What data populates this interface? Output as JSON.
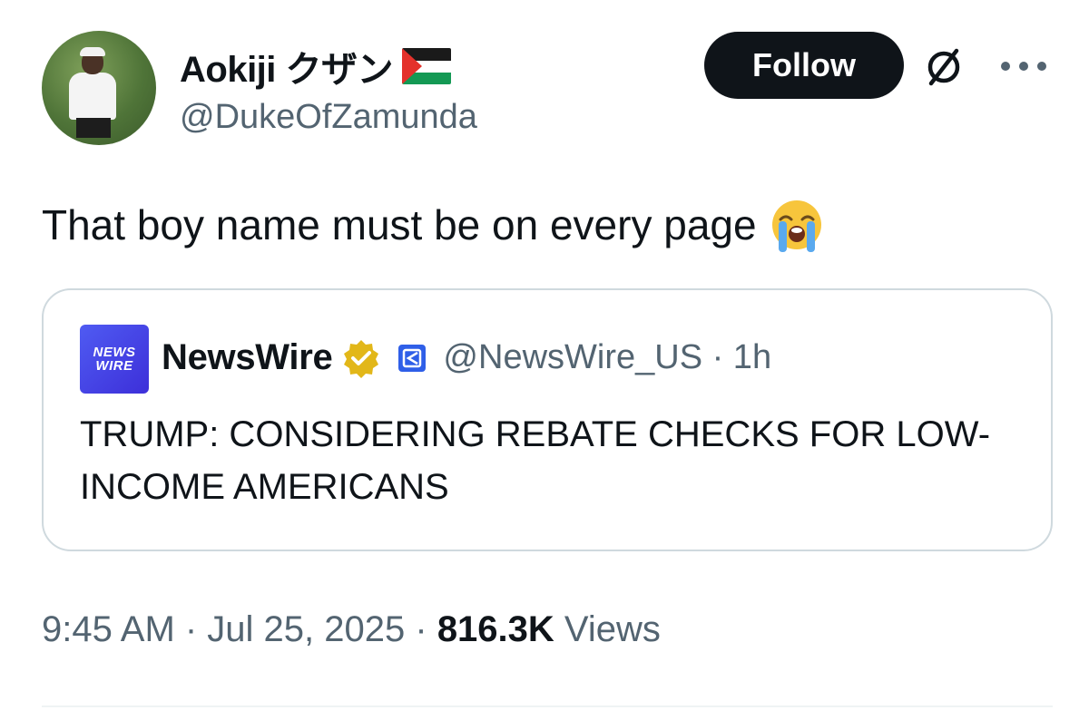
{
  "author": {
    "display_name": "Aokiji クザン",
    "handle": "@DukeOfZamunda",
    "flag_icon": "palestine-flag-icon"
  },
  "header": {
    "follow_label": "Follow",
    "grok_icon": "grok-icon",
    "more_icon": "more-options-icon"
  },
  "tweet": {
    "text": "That boy name must be on every page",
    "emoji_icon": "loudly-crying-face-emoji"
  },
  "quoted_tweet": {
    "avatar_line1": "NEWS",
    "avatar_line2": "WIRE",
    "name": "NewsWire",
    "handle_time": "@NewsWire_US · 1h",
    "text": "TRUMP: CONSIDERING REBATE CHECKS FOR LOW-INCOME AMERICANS"
  },
  "meta": {
    "timestamp": "9:45 AM · Jul 25, 2025 · ",
    "views_count": "816.3K",
    "views_label": " Views"
  },
  "colors": {
    "text_primary": "#0f1419",
    "text_secondary": "#536471",
    "border": "#cfd9de",
    "verified_gold": "#e2b719"
  }
}
